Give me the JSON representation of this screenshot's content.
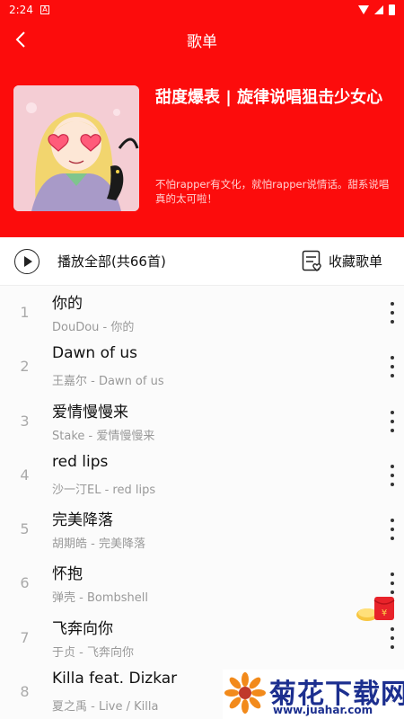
{
  "status": {
    "time": "2:24",
    "notif_icon": "notification-icon"
  },
  "topbar": {
    "title": "歌单",
    "back_icon": "chevron-left-icon"
  },
  "playlist": {
    "name": "甜度爆表 | 旋律说唱狙击少女心",
    "description": "不怕rapper有文化，就怕rapper说情话。甜系说唱真的太可啦！"
  },
  "actions": {
    "play_all": "播放全部(共66首)",
    "collect": "收藏歌单"
  },
  "songs": [
    {
      "num": "1",
      "title": "你的",
      "sub": "DouDou - 你的"
    },
    {
      "num": "2",
      "title": "Dawn of us",
      "sub": "王嘉尔 - Dawn of us"
    },
    {
      "num": "3",
      "title": "爱情慢慢来",
      "sub": "Stake - 爱情慢慢来"
    },
    {
      "num": "4",
      "title": "red lips",
      "sub": "沙一汀EL - red lips"
    },
    {
      "num": "5",
      "title": "完美降落",
      "sub": "胡期皓 - 完美降落"
    },
    {
      "num": "6",
      "title": "怀抱",
      "sub": "弹壳 - Bombshell"
    },
    {
      "num": "7",
      "title": "飞奔向你",
      "sub": "于贞 - 飞奔向你"
    },
    {
      "num": "8",
      "title": "Killa feat. Dizkar",
      "sub": "夏之禹 - Live / Killa"
    }
  ],
  "watermark": {
    "text": "菊花下载网",
    "url": "www.juahar.com"
  },
  "colors": {
    "brand": "#fc0c0c",
    "text": "#111111",
    "muted": "#999999"
  }
}
